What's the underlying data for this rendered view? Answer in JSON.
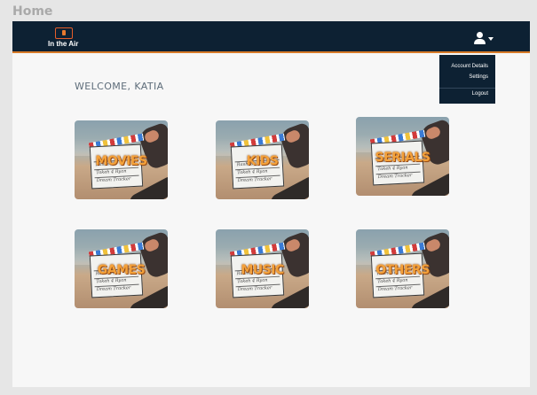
{
  "window": {
    "title": "Home"
  },
  "navbar": {
    "logo_text": "In the Air",
    "user_icon": "user-icon",
    "caret_icon": "caret-down-icon",
    "accent_color": "#d87b28",
    "background_color": "#0d2133"
  },
  "dropdown": {
    "items": [
      {
        "label": "Account Details"
      },
      {
        "label": "Settings"
      },
      {
        "label": "Logout"
      }
    ]
  },
  "main": {
    "welcome": "WELCOME, KATIA",
    "categories": [
      {
        "label": "MOVIES",
        "script1": "Rasheda",
        "script2": "Takeh 4 Ryan",
        "script3": "Dream Tracker"
      },
      {
        "label": "KIDS",
        "script1": "Rasheda",
        "script2": "Takeh 4 Ryan",
        "script3": "Dream Tracker"
      },
      {
        "label": "SERIALS",
        "script1": "Rasheda",
        "script2": "Takeh 4 Ryan",
        "script3": "Dream Tracker"
      },
      {
        "label": "GAMES",
        "script1": "Rasheda",
        "script2": "Takeh 4 Ryan",
        "script3": "Dream Tracker"
      },
      {
        "label": "MUSIC",
        "script1": "Rasheda",
        "script2": "Takeh 4 Ryan",
        "script3": "Dream Tracker"
      },
      {
        "label": "OTHERS",
        "script1": "Rasheda",
        "script2": "Takeh 4 Ryan",
        "script3": "Dream Tracker"
      }
    ]
  }
}
